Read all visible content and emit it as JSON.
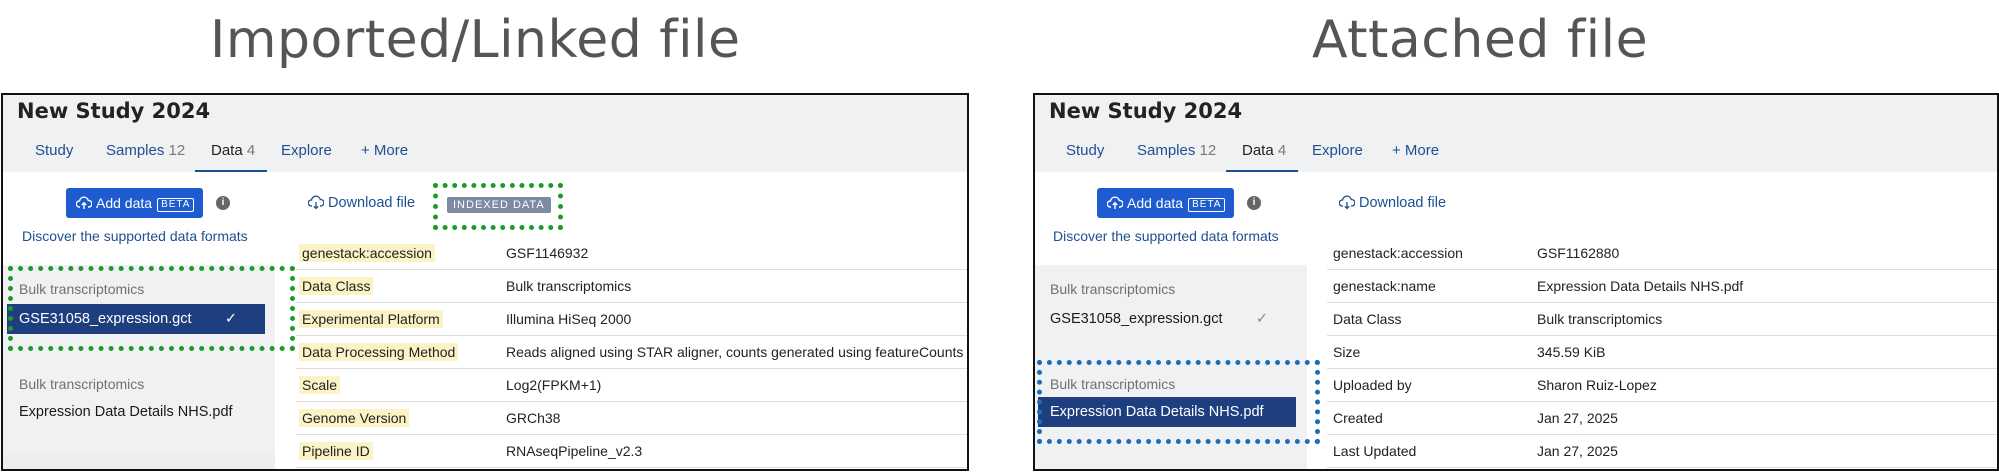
{
  "headings": {
    "left": "Imported/Linked file",
    "right": "Attached file"
  },
  "left_panel": {
    "study_title": "New Study 2024",
    "tabs": [
      {
        "label": "Study",
        "count": ""
      },
      {
        "label": "Samples",
        "count": "12"
      },
      {
        "label": "Data",
        "count": "4"
      },
      {
        "label": "Explore",
        "count": ""
      },
      {
        "label": "+ More",
        "count": ""
      }
    ],
    "active_tab": "Data",
    "add_data_label": "Add data",
    "beta_label": "BETA",
    "info_icon": "i",
    "discover_link": "Discover the supported data formats",
    "download_label": "Download file",
    "indexed_badge": "INDEXED DATA",
    "groups": [
      {
        "label": "Bulk transcriptomics",
        "file": "GSE31058_expression.gct",
        "selected": true
      },
      {
        "label": "Bulk transcriptomics",
        "file": "Expression Data Details NHS.pdf",
        "selected": false
      }
    ],
    "check_icon": "✓",
    "properties": [
      {
        "key": "genestack:accession",
        "value": "GSF1146932"
      },
      {
        "key": "Data Class",
        "value": "Bulk transcriptomics"
      },
      {
        "key": "Experimental Platform",
        "value": "Illumina HiSeq 2000"
      },
      {
        "key": "Data Processing Method",
        "value": "Reads aligned using STAR aligner, counts generated using featureCounts"
      },
      {
        "key": "Scale",
        "value": "Log2(FPKM+1)"
      },
      {
        "key": "Genome Version",
        "value": "GRCh38"
      },
      {
        "key": "Pipeline ID",
        "value": "RNAseqPipeline_v2.3"
      }
    ]
  },
  "right_panel": {
    "study_title": "New Study 2024",
    "tabs": [
      {
        "label": "Study",
        "count": ""
      },
      {
        "label": "Samples",
        "count": "12"
      },
      {
        "label": "Data",
        "count": "4"
      },
      {
        "label": "Explore",
        "count": ""
      },
      {
        "label": "+ More",
        "count": ""
      }
    ],
    "active_tab": "Data",
    "add_data_label": "Add data",
    "beta_label": "BETA",
    "info_icon": "i",
    "discover_link": "Discover the supported data formats",
    "download_label": "Download file",
    "groups": [
      {
        "label": "Bulk transcriptomics",
        "file": "GSE31058_expression.gct",
        "selected": false
      },
      {
        "label": "Bulk transcriptomics",
        "file": "Expression Data Details NHS.pdf",
        "selected": true
      }
    ],
    "check_icon": "✓",
    "properties": [
      {
        "key": "genestack:accession",
        "value": "GSF1162880"
      },
      {
        "key": "genestack:name",
        "value": "Expression Data Details NHS.pdf"
      },
      {
        "key": "Data Class",
        "value": "Bulk transcriptomics"
      },
      {
        "key": "Size",
        "value": "345.59 KiB"
      },
      {
        "key": "Uploaded by",
        "value": "Sharon Ruiz-Lopez"
      },
      {
        "key": "Created",
        "value": "Jan 27, 2025"
      },
      {
        "key": "Last Updated",
        "value": "Jan 27, 2025"
      }
    ]
  },
  "colors": {
    "accent": "#1d4f91",
    "button": "#1f5bd0",
    "selected_row": "#1d3f80",
    "highlight": "#fbf3c5",
    "green_marker": "#1f9a2a",
    "blue_marker": "#1c6db8"
  }
}
